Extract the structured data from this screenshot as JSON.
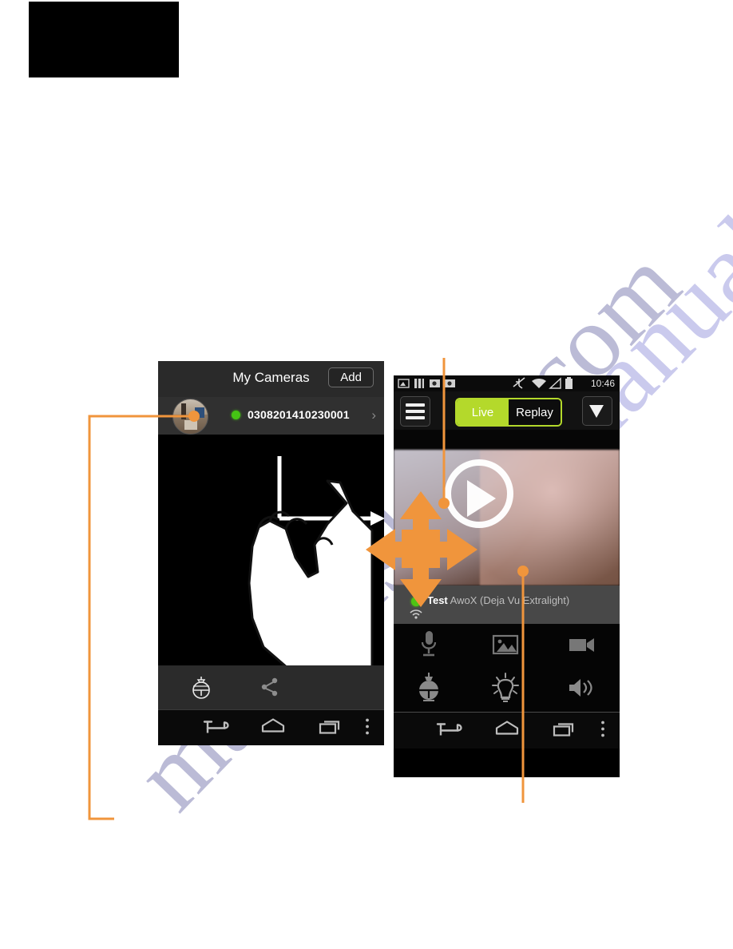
{
  "page": {
    "watermark_text": "manualshive.com",
    "accent_color": "#f0953c",
    "background": "#ffffff"
  },
  "top_block": {
    "name": "black-banner",
    "color": "#000000"
  },
  "left_phone": {
    "header": {
      "title": "My Cameras",
      "add_label": "Add"
    },
    "camera_row": {
      "status_color": "#45c414",
      "serial": "0308201410230001",
      "chevron": "›"
    },
    "toolbar_icons": [
      {
        "name": "camera-dome-icon",
        "label": "Pan/Tilt"
      },
      {
        "name": "share-icon",
        "label": "Share"
      }
    ],
    "nav": {
      "back": "back-icon",
      "home": "home-icon",
      "recents": "recents-icon",
      "overflow": "overflow-menu-icon"
    },
    "video_overlay": {
      "axis_marker": "L-shaped-axis-arrow",
      "hand": "pointing-hand-graphic"
    }
  },
  "right_phone": {
    "status_bar": {
      "time": "10:46",
      "icons": [
        "image-icon",
        "sim-icon",
        "screenshot-icon",
        "camera-icon",
        "vibrate-off-icon",
        "wifi-icon",
        "signal-icon",
        "battery-icon"
      ]
    },
    "top_bar": {
      "menu_icon": "hamburger-menu-icon",
      "live_label": "Live",
      "replay_label": "Replay",
      "active_tab": "Live",
      "active_color": "#b4d92b",
      "dropdown_icon": "chevron-down-icon"
    },
    "player": {
      "play_icon": "play-button-icon"
    },
    "caption": {
      "status_color": "#4dc414",
      "device_name": "Test",
      "device_detail": " AwoX (Deja Vu Extralight)",
      "wifi_icon": "wifi-small-icon"
    },
    "control_icons": [
      {
        "name": "microphone-icon",
        "label": "Microphone"
      },
      {
        "name": "gallery-icon",
        "label": "Photos"
      },
      {
        "name": "video-camera-icon",
        "label": "Record"
      },
      {
        "name": "camera-dome-icon",
        "label": "Pan/Tilt"
      },
      {
        "name": "light-bulb-icon",
        "label": "Light"
      },
      {
        "name": "speaker-icon",
        "label": "Speaker"
      }
    ],
    "nav": {
      "back": "back-icon",
      "home": "home-icon",
      "recents": "recents-icon",
      "overflow": "overflow-menu-icon"
    },
    "gesture_overlay": {
      "name": "four-direction-arrow-overlay",
      "color": "#f0953c"
    }
  },
  "callouts": [
    {
      "name": "callout-left-thumbnail",
      "color": "#f0953c"
    },
    {
      "name": "callout-top-video",
      "color": "#f0953c"
    },
    {
      "name": "callout-bottom-video",
      "color": "#f0953c"
    }
  ]
}
